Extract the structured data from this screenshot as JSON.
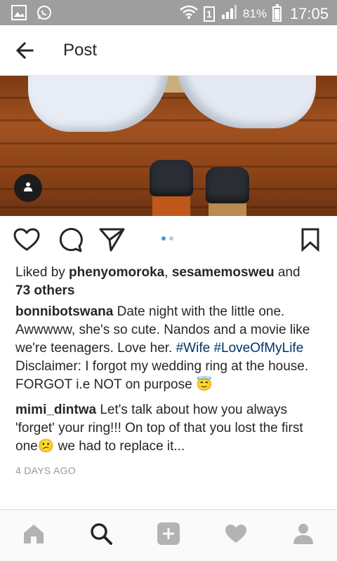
{
  "status_bar": {
    "battery": "81%",
    "time": "17:05",
    "sim_slot": "1"
  },
  "header": {
    "title": "Post"
  },
  "post": {
    "likes": {
      "prefix": "Liked by ",
      "user1": "phenyomoroka",
      "separator": ", ",
      "user2": "sesamemosweu",
      "and_text": " and",
      "others": "73 others"
    },
    "caption": {
      "author": "bonnibotswana",
      "text1": " Date night with the little one. Awwwww, she's so cute. Nandos and a movie like we're teenagers. Love her. ",
      "hashtag1": "#Wife",
      "space": " ",
      "hashtag2": "#LoveOfMyLife",
      "text2": " Disclaimer: I forgot my wedding ring at the house. FORGOT i.e NOT on purpose ",
      "emoji": "😇"
    },
    "comment": {
      "author": "mimi_dintwa",
      "text1": " Let's talk about how you always 'forget' your ring!!! On top of that you lost the first one",
      "emoji": "😕",
      "text2": " we had to replace it..."
    },
    "timestamp": "4 DAYS AGO",
    "carousel": {
      "count": 2,
      "active_index": 0
    }
  },
  "colors": {
    "status_bar": "#9e9e9e",
    "hashtag": "#003569",
    "carousel_active": "#3897f0",
    "text": "#262626",
    "muted": "#999999",
    "nav_icon": "#b3b3b3",
    "nav_active": "#262626"
  },
  "icons": {
    "back": "arrow-left-icon",
    "like": "heart-outline-icon",
    "comment": "comment-bubble-icon",
    "share": "paper-plane-icon",
    "save": "bookmark-icon",
    "user_tag": "person-icon",
    "nav": [
      "home-icon",
      "search-icon",
      "add-icon",
      "heart-icon",
      "profile-icon"
    ]
  }
}
